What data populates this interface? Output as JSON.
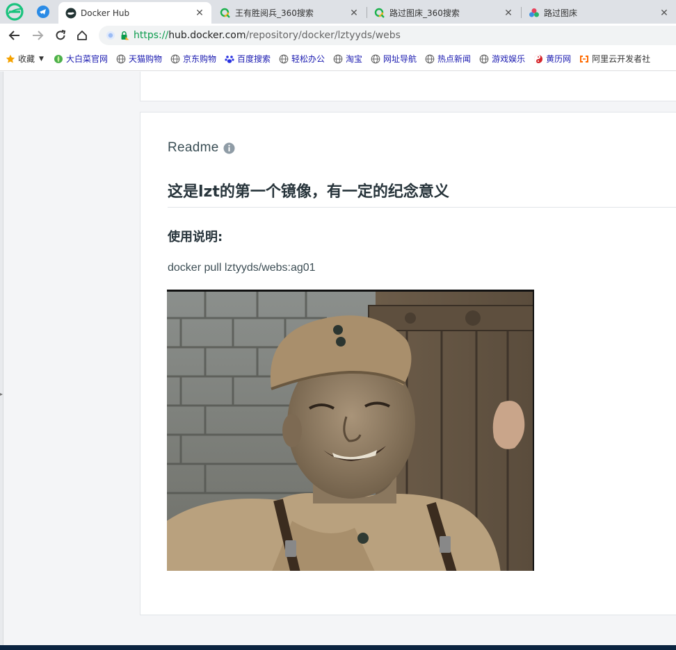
{
  "tabs": [
    {
      "label": "Docker Hub",
      "icon": "docker-whale-icon",
      "active": true
    },
    {
      "label": "王有胜阅兵_360搜索",
      "icon": "360-search-icon",
      "active": false
    },
    {
      "label": "路过图床_360搜索",
      "icon": "360-search-icon",
      "active": false
    },
    {
      "label": "路过图床",
      "icon": "flower-logo-icon",
      "active": false
    }
  ],
  "tab_close_glyph": "✕",
  "address": {
    "scheme": "https://",
    "host": "hub.docker.com",
    "path": "/repository/docker/lztyyds/webs"
  },
  "bookmarks": {
    "root_label": "收藏",
    "items": [
      {
        "label": "大白菜官网",
        "icon": "cabbage-icon"
      },
      {
        "label": "天猫购物",
        "icon": "globe-icon"
      },
      {
        "label": "京东购物",
        "icon": "globe-icon"
      },
      {
        "label": "百度搜索",
        "icon": "baidu-paw-icon"
      },
      {
        "label": "轻松办公",
        "icon": "globe-icon"
      },
      {
        "label": "淘宝",
        "icon": "globe-icon"
      },
      {
        "label": "网址导航",
        "icon": "globe-icon"
      },
      {
        "label": "热点新闻",
        "icon": "globe-icon"
      },
      {
        "label": "游戏娱乐",
        "icon": "globe-icon"
      },
      {
        "label": "黄历网",
        "icon": "yinyang-icon"
      },
      {
        "label": "阿里云开发者社",
        "icon": "aliyun-icon"
      }
    ]
  },
  "readme": {
    "heading": "Readme",
    "title": "这是lzt的第一个镜像，有一定的纪念意义",
    "subtitle": "使用说明:",
    "command": "docker pull lztyyds/webs:ag01"
  },
  "colors": {
    "accent_link": "#1a1ab0",
    "https_green": "#0a9b4c",
    "docker_footer": "#0b2440",
    "heading_text": "#27343b"
  }
}
